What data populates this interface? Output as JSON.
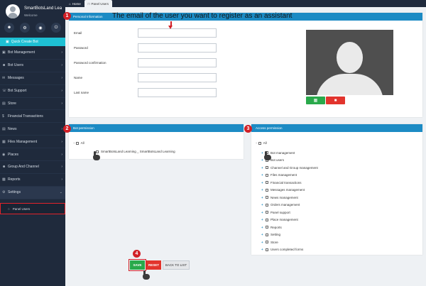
{
  "sidebar": {
    "site_name": "SmartBotsLand Lea",
    "welcome": "Welcome",
    "quick_create": "Quick Create Bot",
    "menu": [
      {
        "label": "Bot Management"
      },
      {
        "label": "Bot Users"
      },
      {
        "label": "Messages"
      },
      {
        "label": "Bot Support"
      },
      {
        "label": "Store"
      },
      {
        "label": "Financial Transactions"
      },
      {
        "label": "News"
      },
      {
        "label": "Files Management"
      },
      {
        "label": "Places"
      },
      {
        "label": "Group And Channel"
      },
      {
        "label": "Reports"
      },
      {
        "label": "Settings"
      }
    ],
    "submenu_panel_users": "Panel Users"
  },
  "topbar": {
    "home": "Home",
    "panel_users": "Panel Users"
  },
  "personal": {
    "header": "Personal Information",
    "fields": [
      {
        "label": "Email"
      },
      {
        "label": "Password"
      },
      {
        "label": "Password confirmation"
      },
      {
        "label": "Name"
      },
      {
        "label": "Last name"
      }
    ]
  },
  "bot_permission": {
    "header": "Bot permission",
    "root": "All",
    "leaf": "SmartBotsLand Learning _ SmartBotsLand Learning"
  },
  "access_permission": {
    "header": "Access permission",
    "root": "All",
    "items": [
      "Bot management",
      "Bot users",
      "Channel and Group management",
      "Files management",
      "Financial transactions",
      "Messages management",
      "News management",
      "Orders management",
      "Panel support",
      "Place management",
      "Reports",
      "Setting",
      "Store",
      "Users completed forms"
    ]
  },
  "buttons": {
    "save": "SAVE",
    "reset": "RESET",
    "back": "BACK TO LIST"
  },
  "annotation": {
    "title": "The email of the user you want to register as an assistant",
    "steps": [
      "1",
      "2",
      "3",
      "4"
    ]
  },
  "colors": {
    "sidebar_bg": "#1f2a3c",
    "accent": "#1ec0d4",
    "header_blue": "#1c8bc4",
    "save_green": "#29a94b",
    "reset_red": "#e2342d",
    "annotation_red": "#d11f26"
  }
}
